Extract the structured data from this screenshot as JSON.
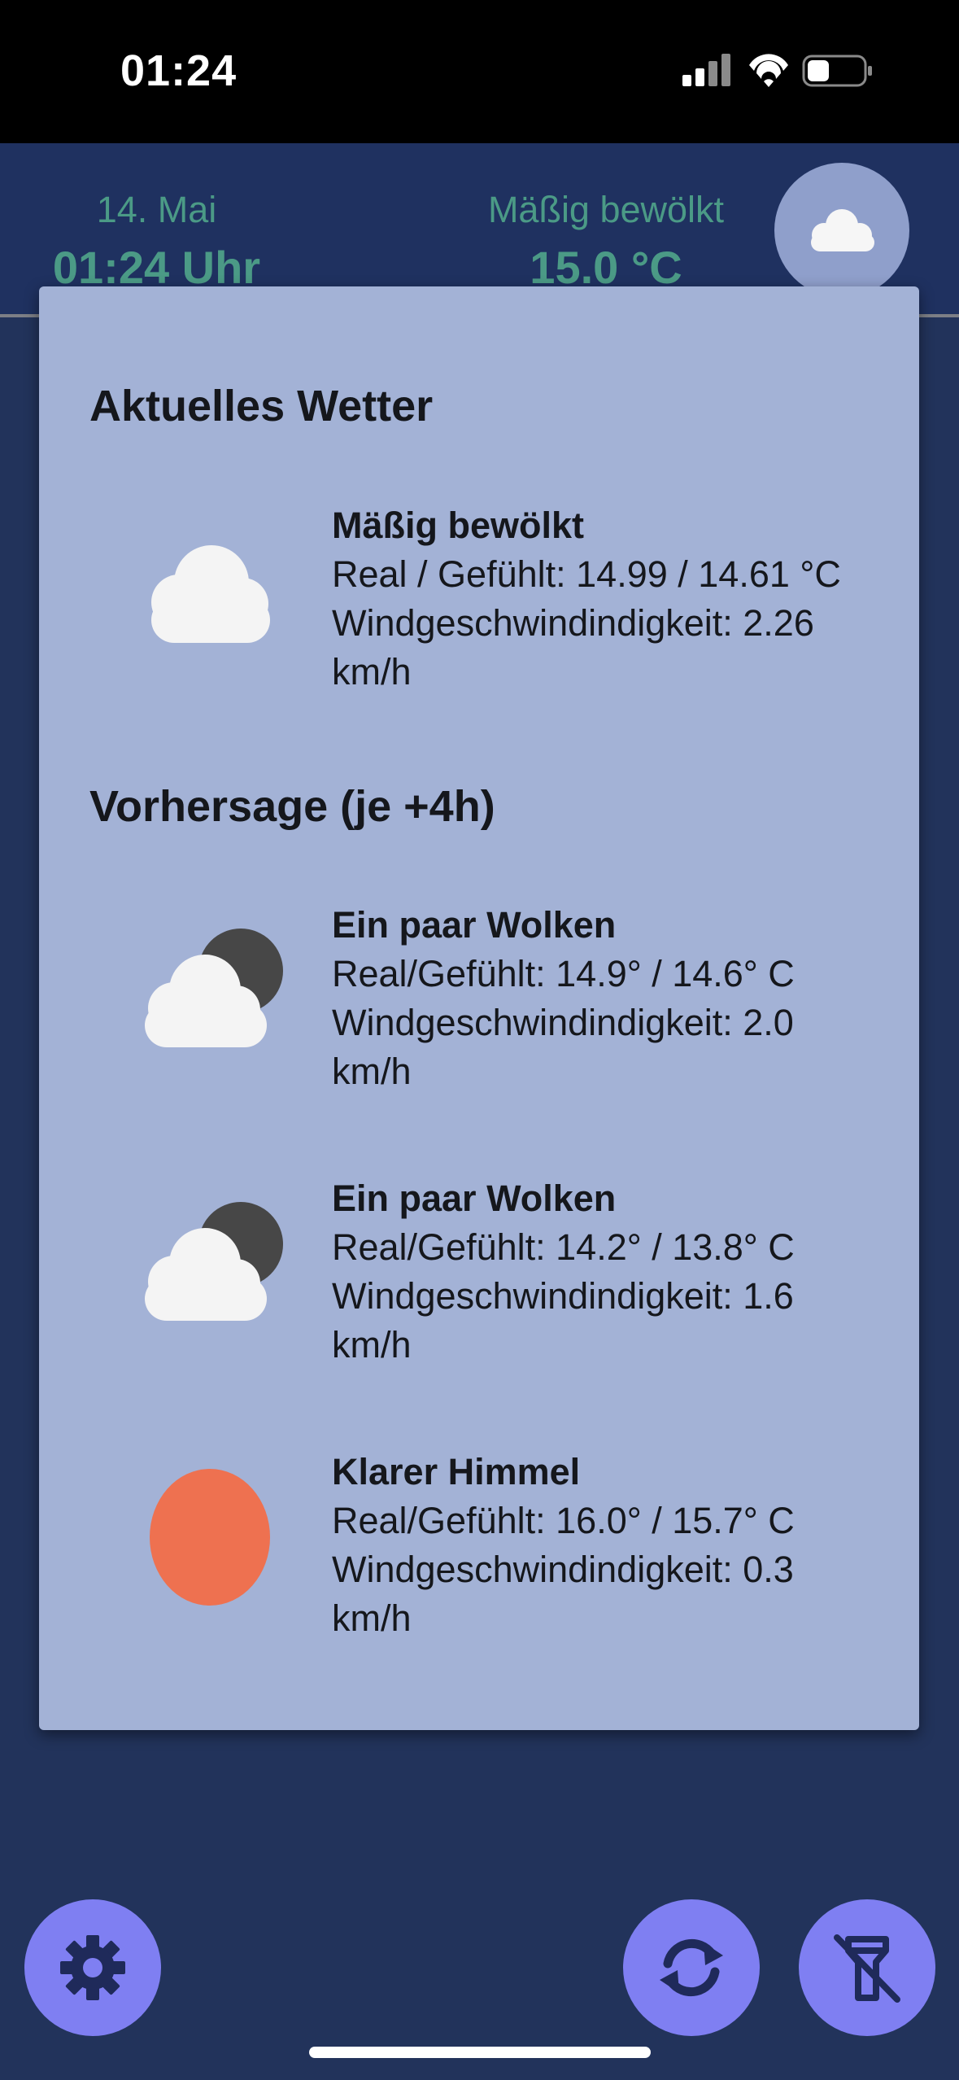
{
  "status_bar": {
    "time": "01:24"
  },
  "header": {
    "date": "14. Mai",
    "time": "01:24 Uhr",
    "condition": "Mäßig bewölkt",
    "temperature": "15.0 °C"
  },
  "current": {
    "heading": "Aktuelles Wetter",
    "title": "Mäßig bewölkt",
    "line1": "Real / Gefühlt: 14.99 / 14.61 °C",
    "line2": "Windgeschwindindigkeit: 2.26",
    "line3": "km/h",
    "icon": "cloud-icon"
  },
  "forecast": {
    "heading": "Vorhersage (je +4h)",
    "items": [
      {
        "title": "Ein paar Wolken",
        "line1": "Real/Gefühlt: 14.9° / 14.6° C",
        "line2": "Windgeschwindindigkeit: 2.0",
        "line3": "km/h",
        "icon": "cloud-moon-icon"
      },
      {
        "title": "Ein paar Wolken",
        "line1": "Real/Gefühlt: 14.2° / 13.8° C",
        "line2": "Windgeschwindindigkeit: 1.6",
        "line3": "km/h",
        "icon": "cloud-moon-icon"
      },
      {
        "title": "Klarer Himmel",
        "line1": "Real/Gefühlt: 16.0° / 15.7° C",
        "line2": "Windgeschwindindigkeit: 0.3",
        "line3": "km/h",
        "icon": "sun-icon"
      }
    ]
  },
  "colors": {
    "background": "#22335b",
    "header": "#1f3160",
    "panel": "#a3b2d6",
    "accent_text": "#4b9a86",
    "fab": "#7f7ff2",
    "sun": "#ee7150"
  },
  "fabs": [
    "gear-icon",
    "refresh-icon",
    "flashlight-off-icon"
  ]
}
